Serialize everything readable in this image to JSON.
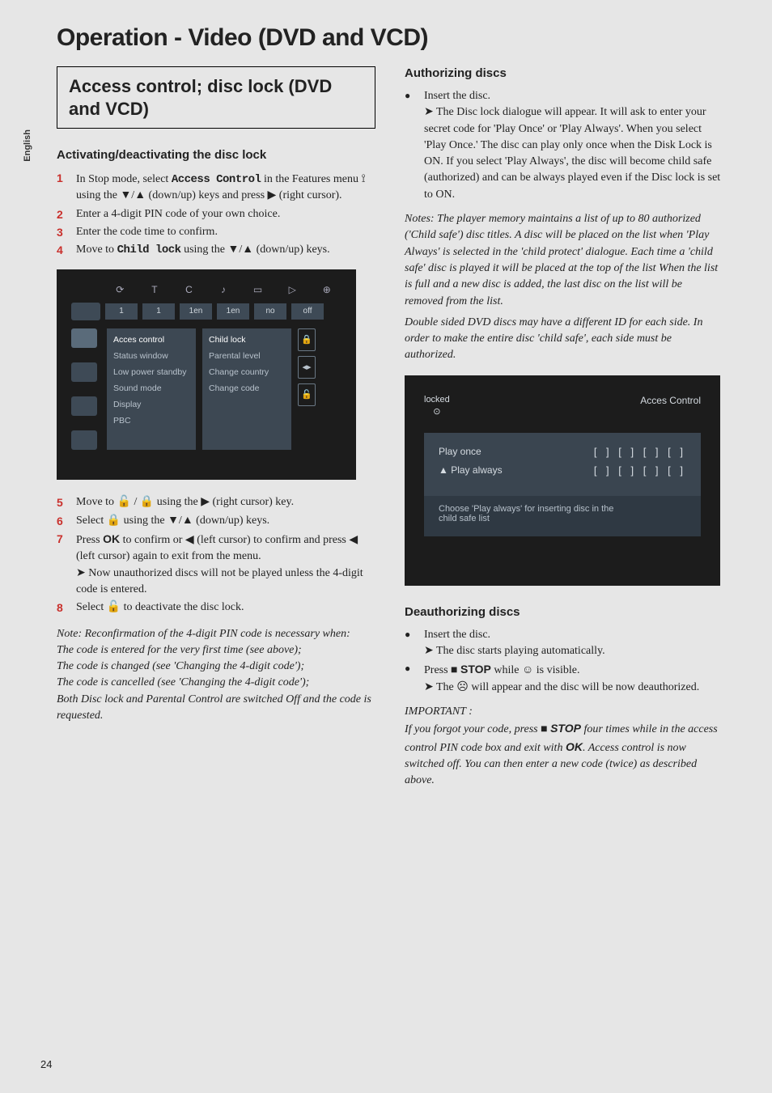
{
  "sideLabel": "English",
  "pageTitle": "Operation - Video (DVD and VCD)",
  "boxHeading": "Access control; disc lock (DVD and VCD)",
  "left": {
    "h_activate": "Activating/deactivating the disc lock",
    "s1a": "In Stop mode, select ",
    "s1b": "Access Control",
    "s1c": " in the Features menu ",
    "s1d": " using the ▼/▲ (down/up) keys and press ▶ (right cursor).",
    "s2": "Enter a 4-digit PIN code of your own choice.",
    "s3": "Enter the code time to confirm.",
    "s4a": "Move to ",
    "s4b": "Child lock",
    "s4c": " using the ▼/▲ (down/up) keys.",
    "s5": "Move to 🔓 / 🔒 using the ▶ (right cursor) key.",
    "s6": "Select 🔒 using the ▼/▲ (down/up) keys.",
    "s7a": "Press ",
    "s7b": "OK",
    "s7c": " to confirm or ◀ (left cursor) to confirm and press ◀ (left cursor) again to exit from the menu.",
    "s7arrow": "➤ Now unauthorized discs will not be played unless the 4-digit code is entered.",
    "s8": "Select 🔓 to deactivate the disc lock.",
    "noteReconfirm": "Note: Reconfirmation of the 4-digit PIN code is necessary when:",
    "nr1": "The code is entered for the very first time (see above);",
    "nr2": "The code is changed (see 'Changing the 4-digit code');",
    "nr3": "The code is cancelled (see 'Changing the 4-digit code');",
    "nr4": "Both Disc lock and Parental Control are switched Off and the code is requested."
  },
  "right": {
    "h_auth": "Authorizing discs",
    "auth_b1": "Insert the disc.",
    "auth_arrow": "➤ The Disc lock dialogue will appear. It will ask to enter your secret code for 'Play Once' or 'Play Always'. When you select 'Play Once.' The disc can play only once when the Disk Lock is ON. If you select 'Play Always', the disc will become child safe (authorized) and can be always played even if the Disc lock is set to ON.",
    "notes1": "Notes: The player memory maintains a list of up to 80 authorized ('Child safe') disc titles. A disc will be placed on the list when 'Play Always' is selected in the 'child protect' dialogue. Each time a 'child safe' disc is played it will be placed at the top of the list When the list is full and a new disc is added, the last disc on the list will be removed from the list.",
    "notes2": "Double sided DVD discs may have a different ID for each side. In order to make the entire disc 'child safe', each side must be authorized.",
    "h_deauth": "Deauthorizing discs",
    "de_b1": "Insert the disc.",
    "de_arrow1": "➤ The disc starts playing automatically.",
    "de_b2a": "Press ■ ",
    "de_b2b": "STOP",
    "de_b2c": " while ☺ is visible.",
    "de_arrow2": "➤ The ☹ will appear and the disc will be now deauthorized.",
    "imp_head": "IMPORTANT :",
    "imp_body_a": "If you forgot your code, press ■ ",
    "imp_body_b": "STOP",
    "imp_body_c": " four times while in the access control PIN code box and exit with ",
    "imp_body_d": "OK",
    "imp_body_e": ". Access control is now switched off. You can then enter a new code (twice) as described above."
  },
  "ss1": {
    "topIcons": [
      "⟳",
      "T",
      "C",
      "♪",
      "▭",
      "▷",
      "⊕"
    ],
    "topVals": [
      "1",
      "1",
      "1en",
      "1en",
      "no",
      "off"
    ],
    "col1": [
      "Acces control",
      "Status window",
      "Low power standby",
      "Sound mode",
      "Display",
      "PBC"
    ],
    "col2": [
      "Child lock",
      "Parental level",
      "Change country",
      "Change code"
    ]
  },
  "ss2": {
    "locked": "locked",
    "title": "Acces Control",
    "playOnce": "Play once",
    "playAlways": "▲ Play always",
    "code": "[ ] [ ] [ ] [ ]",
    "line1": "Choose 'Play always' for inserting disc in the",
    "line2": "child safe list"
  },
  "pageNumber": "24"
}
